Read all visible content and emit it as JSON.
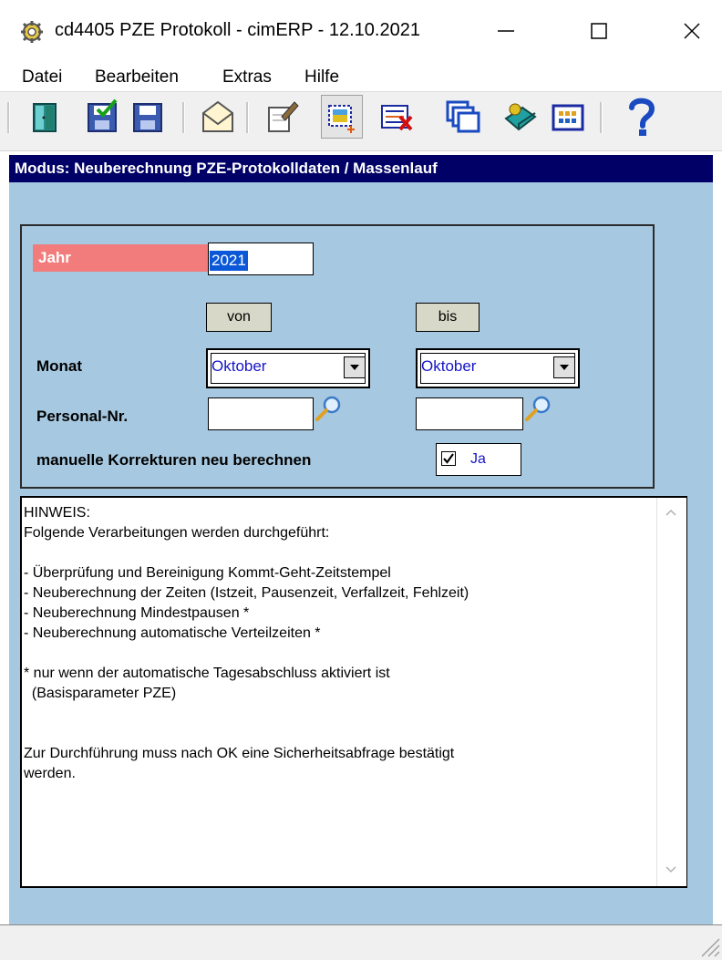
{
  "window": {
    "title": "cd4405 PZE Protokoll - cimERP - 12.10.2021",
    "icon": "gear-icon",
    "controls": [
      "minimize-icon",
      "maximize-icon",
      "close-icon"
    ]
  },
  "menu": {
    "items": [
      {
        "label": "Datei"
      },
      {
        "label": "Bearbeiten"
      },
      {
        "label": "Extras"
      },
      {
        "label": "Hilfe"
      }
    ]
  },
  "toolbar": {
    "buttons": [
      "exit-door-icon",
      "save-check-icon",
      "save-icon",
      "mail-icon",
      "edit-document-icon",
      "new-selection-icon",
      "delete-record-icon",
      "windows-icon",
      "print-book-icon",
      "calendar-grid-icon",
      "help-icon"
    ]
  },
  "mode": {
    "text": "Modus: Neuberechnung PZE-Protokolldaten / Massenlauf",
    "background": "#000066"
  },
  "form": {
    "jahr_label": "Jahr",
    "jahr_value": "2021",
    "von_label": "von",
    "bis_label": "bis",
    "monat_label": "Monat",
    "monat_von_value": "Oktober",
    "monat_bis_value": "Oktober",
    "personal_label": "Personal-Nr.",
    "personal_von_value": "",
    "personal_bis_value": "",
    "korrektur_label": "manuelle Korrekturen neu berechnen",
    "korrektur_checked": true,
    "korrektur_value": "Ja"
  },
  "hinweis": {
    "text": "HINWEIS:\nFolgende Verarbeitungen werden durchgeführt:\n\n- Überprüfung und Bereinigung Kommt-Geht-Zeitstempel\n- Neuberechnung der Zeiten (Istzeit, Pausenzeit, Verfallzeit, Fehlzeit)\n- Neuberechnung Mindestpausen *\n- Neuberechnung automatische Verteilzeiten *\n\n* nur wenn der automatische Tagesabschluss aktiviert ist\n  (Basisparameter PZE)\n\n\nZur Durchführung muss nach OK eine Sicherheitsabfrage bestätigt\nwerden."
  },
  "colors": {
    "client_background": "#a6c8e0",
    "jahr_label_background": "#f27c7c",
    "combo_text": "#1515c8"
  }
}
